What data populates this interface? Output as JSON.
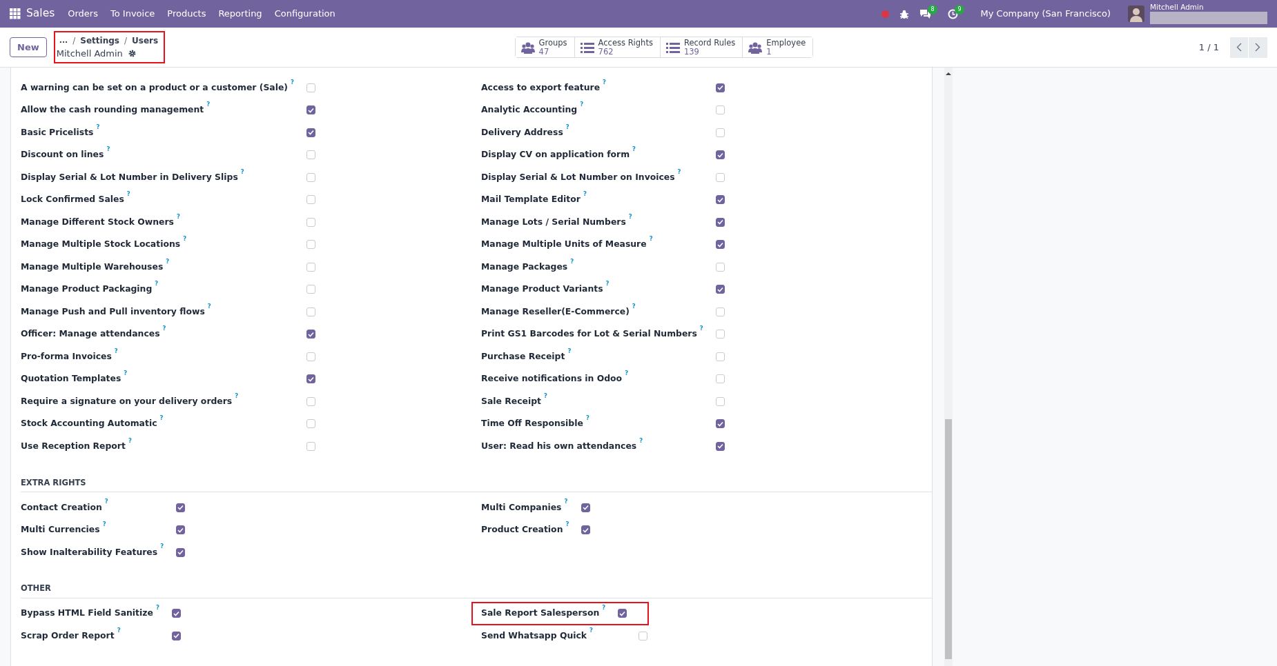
{
  "navbar": {
    "app": "Sales",
    "menu": [
      "Orders",
      "To Invoice",
      "Products",
      "Reporting",
      "Configuration"
    ],
    "chat_count": "8",
    "activity_count": "9",
    "company": "My Company (San Francisco)",
    "user": "Mitchell Admin"
  },
  "control_panel": {
    "new_button": "New",
    "breadcrumb": {
      "ellipsis": "...",
      "separator": "/",
      "items": [
        "Settings",
        "Users"
      ],
      "record": "Mitchell Admin",
      "highlighted": true
    },
    "stat_buttons": [
      {
        "kind": "people",
        "label": "Groups",
        "value": "47"
      },
      {
        "kind": "list",
        "label": "Access Rights",
        "value": "762"
      },
      {
        "kind": "list",
        "label": "Record Rules",
        "value": "139"
      },
      {
        "kind": "people",
        "label": "Employee",
        "value": "1"
      }
    ],
    "pager": "1 / 1"
  },
  "sections": [
    {
      "left": [
        {
          "label": "A warning can be set on a product or a customer (Sale)",
          "help": "?",
          "checked": false
        },
        {
          "label": "Allow the cash rounding management",
          "help": "?",
          "checked": true
        },
        {
          "label": "Basic Pricelists",
          "help": "?",
          "checked": true
        },
        {
          "label": "Discount on lines",
          "help": "?",
          "checked": false
        },
        {
          "label": "Display Serial & Lot Number in Delivery Slips",
          "help": "?",
          "checked": false
        },
        {
          "label": "Lock Confirmed Sales",
          "help": "?",
          "checked": false
        },
        {
          "label": "Manage Different Stock Owners",
          "help": "?",
          "checked": false
        },
        {
          "label": "Manage Multiple Stock Locations",
          "help": "?",
          "checked": false
        },
        {
          "label": "Manage Multiple Warehouses",
          "help": "?",
          "checked": false
        },
        {
          "label": "Manage Product Packaging",
          "help": "?",
          "checked": false
        },
        {
          "label": "Manage Push and Pull inventory flows",
          "help": "?",
          "checked": false
        },
        {
          "label": "Officer: Manage attendances",
          "help": "?",
          "checked": true
        },
        {
          "label": "Pro-forma Invoices",
          "help": "?",
          "checked": false
        },
        {
          "label": "Quotation Templates",
          "help": "?",
          "checked": true
        },
        {
          "label": "Require a signature on your delivery orders",
          "help": "?",
          "checked": false
        },
        {
          "label": "Stock Accounting Automatic",
          "help": "?",
          "checked": false
        },
        {
          "label": "Use Reception Report",
          "help": "?",
          "checked": false
        }
      ],
      "right": [
        {
          "label": "Access to export feature",
          "help": "?",
          "checked": true
        },
        {
          "label": "Analytic Accounting",
          "help": "?",
          "checked": false
        },
        {
          "label": "Delivery Address",
          "help": "?",
          "checked": false
        },
        {
          "label": "Display CV on application form",
          "help": "?",
          "checked": true
        },
        {
          "label": "Display Serial & Lot Number on Invoices",
          "help": "?",
          "checked": false
        },
        {
          "label": "Mail Template Editor",
          "help": "?",
          "checked": true
        },
        {
          "label": "Manage Lots / Serial Numbers",
          "help": "?",
          "checked": true
        },
        {
          "label": "Manage Multiple Units of Measure",
          "help": "?",
          "checked": true
        },
        {
          "label": "Manage Packages",
          "help": "?",
          "checked": false
        },
        {
          "label": "Manage Product Variants",
          "help": "?",
          "checked": true
        },
        {
          "label": "Manage Reseller(E-Commerce)",
          "help": "?",
          "checked": false
        },
        {
          "label": "Print GS1 Barcodes for Lot & Serial Numbers",
          "help": "?",
          "checked": false
        },
        {
          "label": "Purchase Receipt",
          "help": "?",
          "checked": false
        },
        {
          "label": "Receive notifications in Odoo",
          "help": "?",
          "checked": false
        },
        {
          "label": "Sale Receipt",
          "help": "?",
          "checked": false
        },
        {
          "label": "Time Off Responsible",
          "help": "?",
          "checked": true
        },
        {
          "label": "User: Read his own attendances",
          "help": "?",
          "checked": true
        }
      ]
    },
    {
      "title": "EXTRA RIGHTS",
      "left": [
        {
          "label": "Contact Creation",
          "help": "?",
          "checked": true
        },
        {
          "label": "Multi Currencies",
          "help": "?",
          "checked": true
        },
        {
          "label": "Show Inalterability Features",
          "help": "?",
          "checked": true
        }
      ],
      "right": [
        {
          "label": "Multi Companies",
          "help": "?",
          "checked": true
        },
        {
          "label": "Product Creation",
          "help": "?",
          "checked": true
        }
      ]
    },
    {
      "title": "OTHER",
      "left": [
        {
          "label": "Bypass HTML Field Sanitize",
          "help": "?",
          "checked": true
        },
        {
          "label": "Scrap Order Report",
          "help": "?",
          "checked": true
        }
      ],
      "right": [
        {
          "label": "Sale Report Salesperson",
          "help": "?",
          "checked": true,
          "highlighted": true
        },
        {
          "label": "Send Whatsapp Quick",
          "help": "?",
          "checked": false
        }
      ]
    }
  ]
}
